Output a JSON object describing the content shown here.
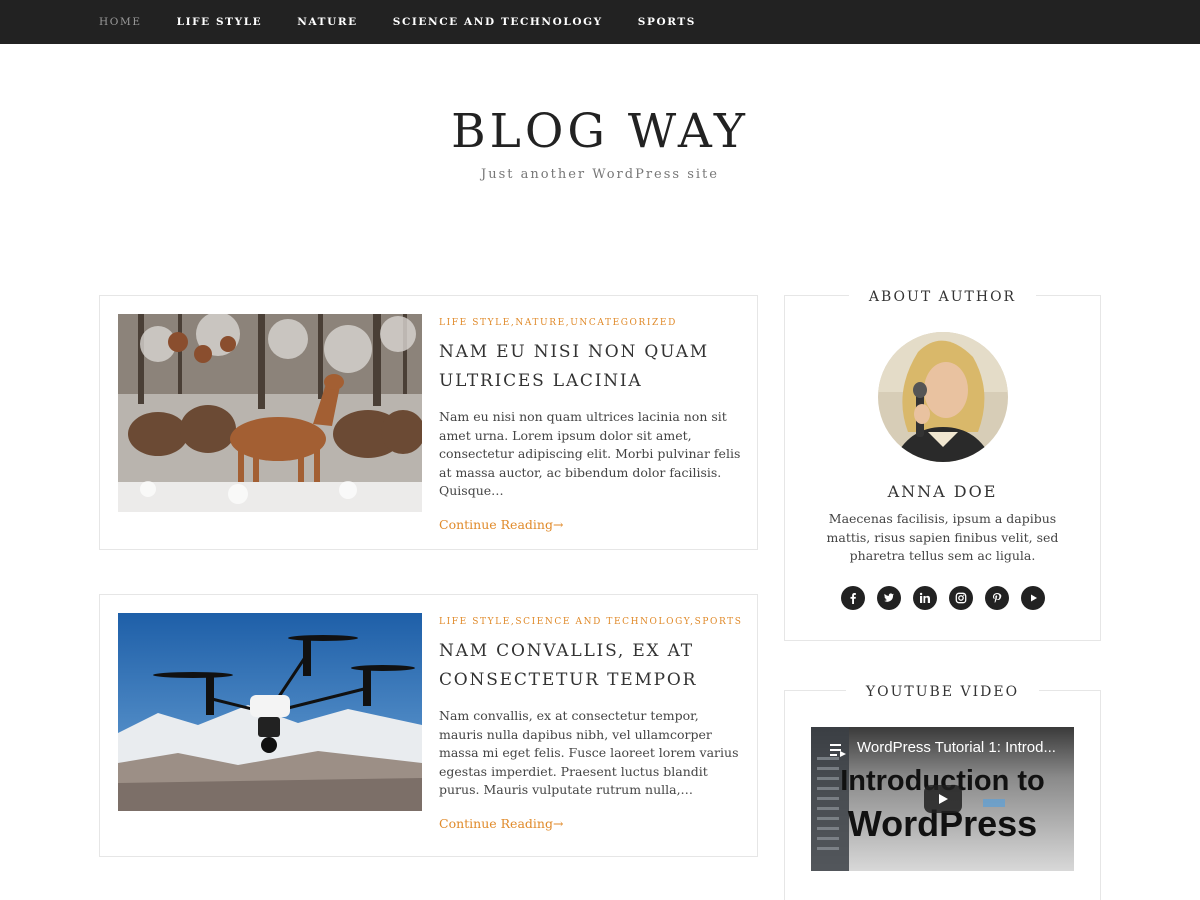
{
  "nav": {
    "items": [
      "HOME",
      "LIFE STYLE",
      "NATURE",
      "SCIENCE AND TECHNOLOGY",
      "SPORTS"
    ],
    "active_index": 0
  },
  "header": {
    "title": "BLOG WAY",
    "tagline": "Just another WordPress site"
  },
  "posts": [
    {
      "categories": [
        "LIFE STYLE",
        "NATURE",
        "UNCATEGORIZED"
      ],
      "title": "NAM EU NISI NON QUAM ULTRICES LACINIA",
      "excerpt": "Nam eu nisi non quam ultrices lacinia non sit amet urna. Lorem ipsum dolor sit amet, consectetur adipiscing elit. Morbi pulvinar felis at massa auctor, ac bibendum dolor facilisis. Quisque…",
      "read_more": "Continue Reading→",
      "image": "deer-herd-in-snow"
    },
    {
      "categories": [
        "LIFE STYLE",
        "SCIENCE AND TECHNOLOGY",
        "SPORTS"
      ],
      "title": "NAM CONVALLIS, EX AT CONSECTETUR TEMPOR",
      "excerpt": "Nam convallis, ex at consectetur tempor, mauris nulla dapibus nibh, vel ullamcorper massa mi eget felis. Fusce laoreet lorem varius egestas imperdiet. Praesent luctus blandit purus. Mauris vulputate rutrum nulla,…",
      "read_more": "Continue Reading→",
      "image": "drone-over-mountains"
    }
  ],
  "sidebar": {
    "about": {
      "title": "ABOUT AUTHOR",
      "name": "ANNA DOE",
      "bio": "Maecenas facilisis, ipsum a dapibus mattis, risus sapien finibus velit, sed pharetra tellus sem ac ligula.",
      "socials": [
        "facebook-icon",
        "twitter-icon",
        "linkedin-icon",
        "instagram-icon",
        "pinterest-icon",
        "youtube-icon"
      ]
    },
    "youtube": {
      "title": "YOUTUBE VIDEO",
      "video_title": "WordPress Tutorial 1: Introd...",
      "overlay_line1": "Introduction to",
      "overlay_line2": "WordPress"
    }
  },
  "colors": {
    "nav_bg": "#222222",
    "accent": "#e08a2a",
    "text": "#333333",
    "border": "#e6e6e6"
  }
}
